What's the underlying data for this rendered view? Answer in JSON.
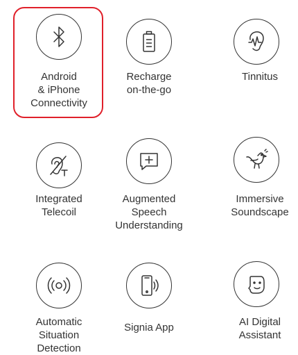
{
  "accent_color": "#e0202a",
  "features": [
    {
      "label": "Android\n& iPhone\nConnectivity",
      "icon": "bluetooth-icon",
      "selected": true
    },
    {
      "label": "Recharge\non-the-go",
      "icon": "battery-icon",
      "selected": false
    },
    {
      "label": "Tinnitus",
      "icon": "ear-wave-icon",
      "selected": false
    },
    {
      "label": "Integrated\nTelecoil",
      "icon": "telecoil-ear-icon",
      "selected": false
    },
    {
      "label": "Augmented\nSpeech\nUnderstanding",
      "icon": "speech-bubble-plus-icon",
      "selected": false
    },
    {
      "label": "Immersive\nSoundscape",
      "icon": "bird-icon",
      "selected": false
    },
    {
      "label": "Automatic\nSituation\nDetection",
      "icon": "sound-waves-icon",
      "selected": false
    },
    {
      "label": "Signia App",
      "icon": "phone-sound-icon",
      "selected": false
    },
    {
      "label": "AI Digital\nAssistant",
      "icon": "face-assistant-icon",
      "selected": false
    }
  ]
}
